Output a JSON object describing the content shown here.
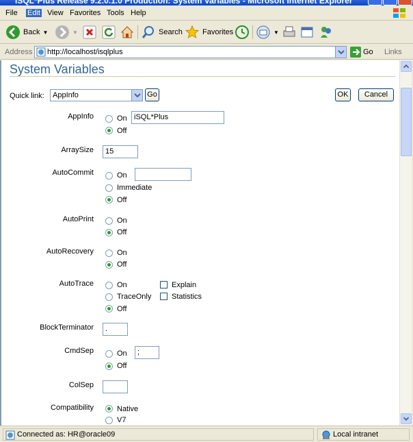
{
  "window": {
    "title": "iSQL*Plus Release 9.2.0.1.0 Production: System Variables - Microsoft Internet Explorer"
  },
  "menu": [
    "File",
    "Edit",
    "View",
    "Favorites",
    "Tools",
    "Help"
  ],
  "toolbar": {
    "back": "Back",
    "search": "Search",
    "favorites": "Favorites"
  },
  "address": {
    "label": "Address",
    "url": "http://localhost/isqlplus",
    "go": "Go",
    "links": "Links"
  },
  "page": {
    "title": "System Variables",
    "quick_link_label": "Quick link:",
    "quick_link_value": "AppInfo",
    "go_button": "Go",
    "ok_button": "OK",
    "cancel_button": "Cancel"
  },
  "variables": {
    "appinfo": {
      "label": "AppInfo",
      "on": "On",
      "off": "Off",
      "value": "iSQL*Plus",
      "selected": "Off"
    },
    "arraysize": {
      "label": "ArraySize",
      "value": "15"
    },
    "autocommit": {
      "label": "AutoCommit",
      "on": "On",
      "immediate": "Immediate",
      "off": "Off",
      "value": "",
      "selected": "Off"
    },
    "autoprint": {
      "label": "AutoPrint",
      "on": "On",
      "off": "Off",
      "selected": "Off"
    },
    "autorecovery": {
      "label": "AutoRecovery",
      "on": "On",
      "off": "Off",
      "selected": "Off"
    },
    "autotrace": {
      "label": "AutoTrace",
      "on": "On",
      "traceonly": "TraceOnly",
      "off": "Off",
      "explain": "Explain",
      "statistics": "Statistics",
      "selected": "Off"
    },
    "blockterminator": {
      "label": "BlockTerminator",
      "value": "."
    },
    "cmdsep": {
      "label": "CmdSep",
      "on": "On",
      "off": "Off",
      "value": ";",
      "selected": "Off"
    },
    "colsep": {
      "label": "ColSep",
      "value": ""
    },
    "compatibility": {
      "label": "Compatibility",
      "native": "Native",
      "v7": "V7",
      "selected": "Native"
    }
  },
  "status": {
    "left": "Connected as: HR@oracle09",
    "right": "Local intranet"
  }
}
